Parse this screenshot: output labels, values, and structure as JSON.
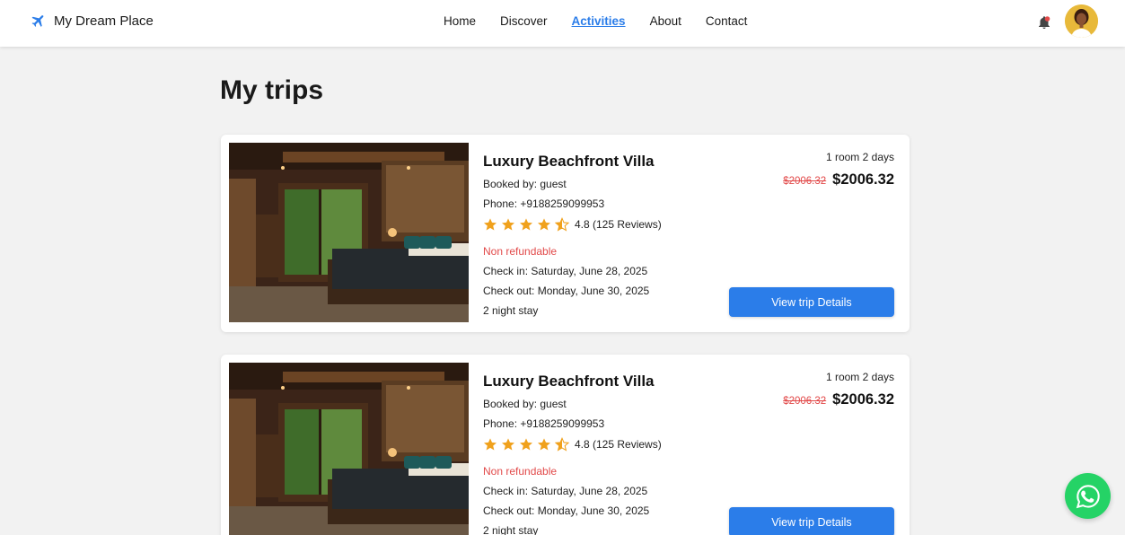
{
  "header": {
    "brand": "My Dream Place",
    "nav": [
      {
        "label": "Home",
        "active": false
      },
      {
        "label": "Discover",
        "active": false
      },
      {
        "label": "Activities",
        "active": true
      },
      {
        "label": "About",
        "active": false
      },
      {
        "label": "Contact",
        "active": false
      }
    ],
    "icons": {
      "logo": "airplane-icon",
      "notifications": "bell-icon",
      "avatar": "user-avatar"
    }
  },
  "page": {
    "title": "My trips"
  },
  "trips": [
    {
      "name": "Luxury Beachfront Villa",
      "booked_by": "Booked by: guest",
      "phone": "Phone: +9188259099953",
      "rating": 4.5,
      "rating_text": "4.8 (125 Reviews)",
      "refund_policy": "Non refundable",
      "check_in": "Check in: Saturday, June 28, 2025",
      "check_out": "Check out: Monday, June 30, 2025",
      "nights": "2 night stay",
      "room_days": "1 room 2 days",
      "old_price": "$2006.32",
      "price": "$2006.32",
      "button": "View trip Details"
    },
    {
      "name": "Luxury Beachfront Villa",
      "booked_by": "Booked by: guest",
      "phone": "Phone: +9188259099953",
      "rating": 4.5,
      "rating_text": "4.8 (125 Reviews)",
      "refund_policy": "Non refundable",
      "check_in": "Check in: Saturday, June 28, 2025",
      "check_out": "Check out: Monday, June 30, 2025",
      "nights": "2 night stay",
      "room_days": "1 room 2 days",
      "old_price": "$2006.32",
      "price": "$2006.32",
      "button": "View trip Details"
    }
  ],
  "colors": {
    "accent": "#2b7de9",
    "danger": "#e24a4a",
    "star": "#f0a11c",
    "whatsapp": "#25d366",
    "background": "#f2f2f2"
  },
  "floating": {
    "whatsapp_icon": "whatsapp-icon"
  }
}
